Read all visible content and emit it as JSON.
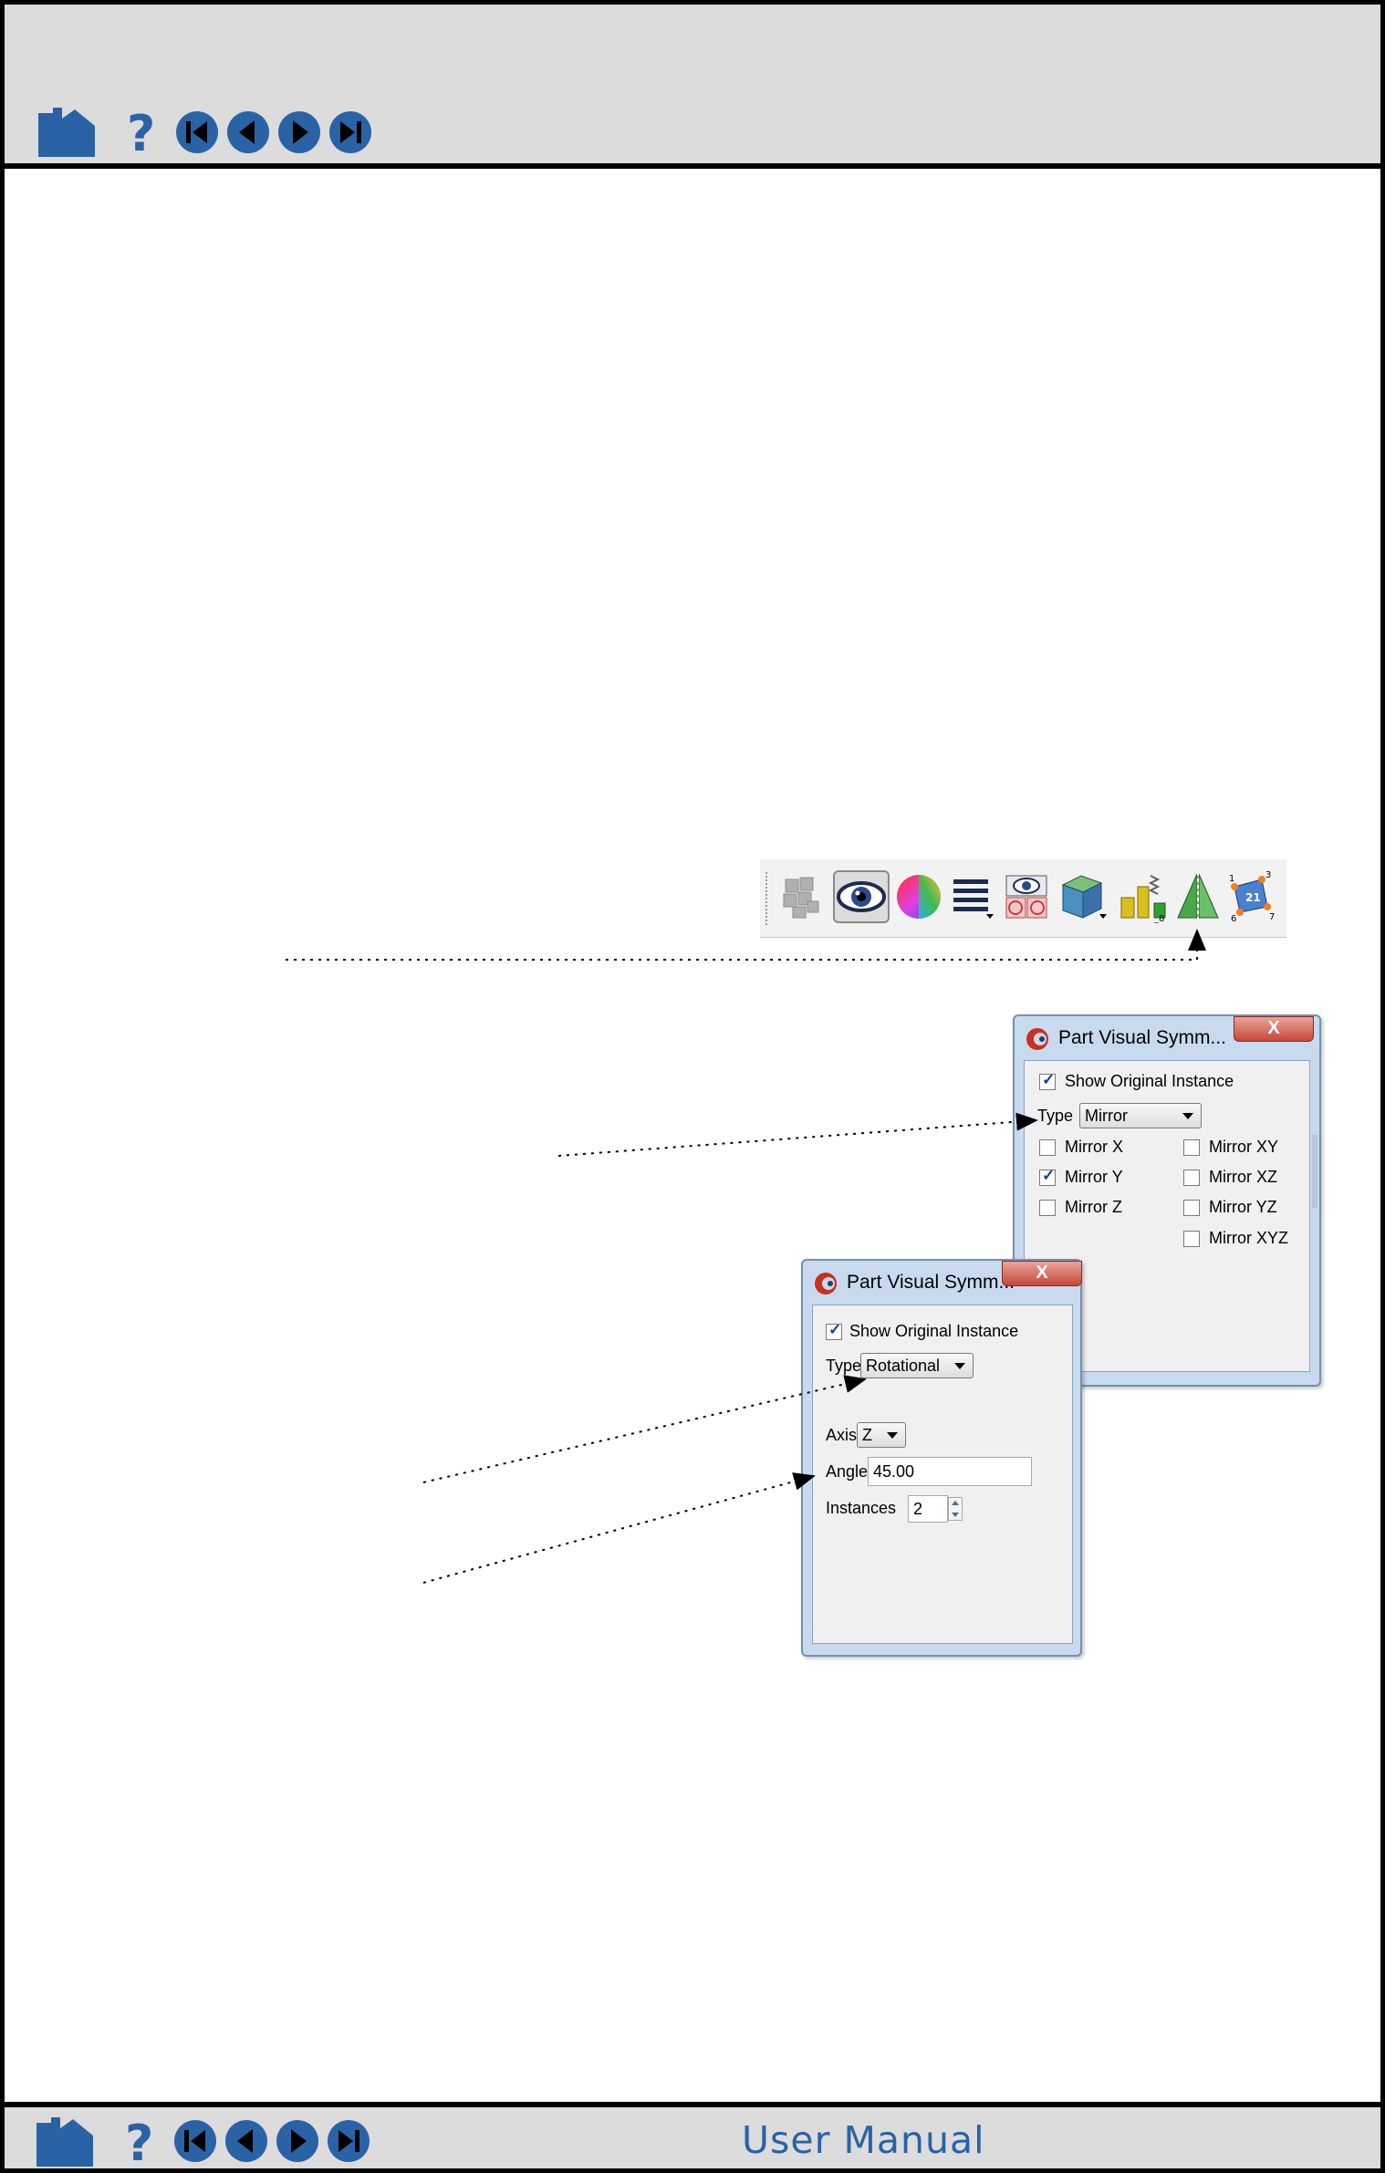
{
  "header": {
    "nav_icons": [
      "home-icon",
      "help-icon",
      "first-page-icon",
      "previous-page-icon",
      "next-page-icon",
      "last-page-icon"
    ]
  },
  "footer": {
    "title": "User Manual",
    "nav_icons": [
      "home-icon",
      "help-icon",
      "first-page-icon",
      "previous-page-icon",
      "next-page-icon",
      "last-page-icon"
    ]
  },
  "toolbar": {
    "icons": [
      "parts-icon",
      "visibility-eye-icon",
      "color-wheel-icon",
      "line-style-icon",
      "hidden-surface-icon",
      "cube-grid-icon",
      "displacement-icon",
      "symmetry-icon",
      "node-labels-icon"
    ]
  },
  "mirror_dialog": {
    "title": "Part Visual Symm...",
    "close_label": "X",
    "show_original": {
      "label": "Show Original Instance",
      "checked": true
    },
    "type_label": "Type",
    "type_value": "Mirror",
    "options": [
      {
        "label": "Mirror X",
        "checked": false
      },
      {
        "label": "Mirror Y",
        "checked": true
      },
      {
        "label": "Mirror Z",
        "checked": false
      },
      {
        "label": "Mirror XY",
        "checked": false
      },
      {
        "label": "Mirror XZ",
        "checked": false
      },
      {
        "label": "Mirror YZ",
        "checked": false
      },
      {
        "label": "Mirror XYZ",
        "checked": false
      }
    ]
  },
  "rotational_dialog": {
    "title": "Part Visual Symm...",
    "close_label": "X",
    "show_original": {
      "label": "Show Original Instance",
      "checked": true
    },
    "type_label": "Type",
    "type_value": "Rotational",
    "axis_label": "Axis",
    "axis_value": "Z",
    "angle_label": "Angle",
    "angle_value": "45.00",
    "instances_label": "Instances",
    "instances_value": "2"
  },
  "colors": {
    "chrome_gray": "#dcdcdc",
    "nav_blue": "#2a62a6",
    "dialog_frame": "#c8daee"
  }
}
